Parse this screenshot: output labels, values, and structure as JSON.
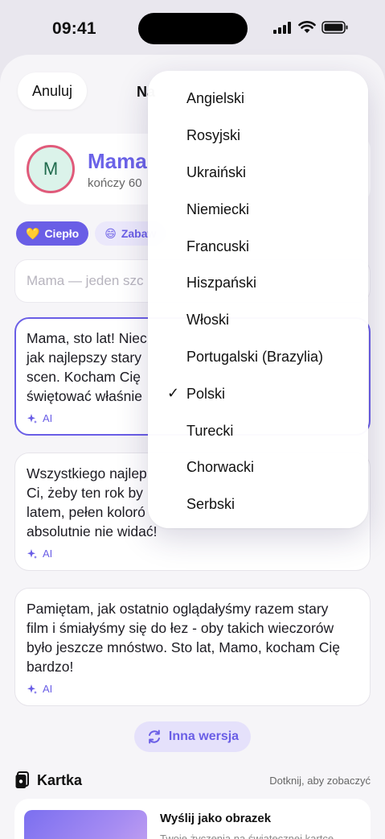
{
  "status_bar": {
    "time": "09:41"
  },
  "header": {
    "cancel_label": "Anuluj",
    "title_partial": "Na"
  },
  "recipient": {
    "initial": "M",
    "name": "Mama",
    "subtitle": "kończy 60"
  },
  "tones": [
    {
      "emoji": "💛",
      "label": "Ciepło",
      "active": true
    },
    {
      "emoji": "😄",
      "label": "Zabaw",
      "active": false
    }
  ],
  "prompt": {
    "text": "Mama — jeden szc"
  },
  "wishes": [
    {
      "text": "Mama, sto lat! Nie… jak najlepszy stary… scen. Kocham Cię… świętować właśnie",
      "lines": [
        "Mama, sto lat! Niec",
        "jak najlepszy stary",
        "scen. Kocham Cię",
        "świętować właśnie"
      ],
      "ai_label": "AI",
      "selected": true
    },
    {
      "lines": [
        "Wszystkiego najlep",
        "Ci, żeby ten rok by",
        "latem, pełen koloró",
        "absolutnie nie widać!"
      ],
      "ai_label": "AI",
      "selected": false
    },
    {
      "lines": [
        "Pamiętam, jak ostatnio oglądałyśmy razem stary",
        "film i śmiałyśmy się do łez - oby takich wieczorów",
        "było jeszcze mnóstwo. Sto lat, Mamo, kocham Cię",
        "bardzo!"
      ],
      "ai_label": "AI",
      "selected": false
    }
  ],
  "regenerate_label": "Inna wersja",
  "card_section": {
    "title": "Kartka",
    "hint": "Dotknij, aby zobaczyć",
    "send_title": "Wyślij jako obrazek",
    "send_subtitle": "Twoje życzenia na świątecznej kartce"
  },
  "language_menu": {
    "items": [
      {
        "label": "Angielski",
        "checked": false
      },
      {
        "label": "Rosyjski",
        "checked": false
      },
      {
        "label": "Ukraiński",
        "checked": false
      },
      {
        "label": "Niemiecki",
        "checked": false
      },
      {
        "label": "Francuski",
        "checked": false
      },
      {
        "label": "Hiszpański",
        "checked": false
      },
      {
        "label": "Włoski",
        "checked": false
      },
      {
        "label": "Portugalski (Brazylia)",
        "checked": false
      },
      {
        "label": "Polski",
        "checked": true
      },
      {
        "label": "Turecki",
        "checked": false
      },
      {
        "label": "Chorwacki",
        "checked": false
      },
      {
        "label": "Serbski",
        "checked": false
      }
    ],
    "check_glyph": "✓"
  },
  "colors": {
    "accent": "#6a5ee6",
    "avatar_ring": "#e05a7a"
  }
}
